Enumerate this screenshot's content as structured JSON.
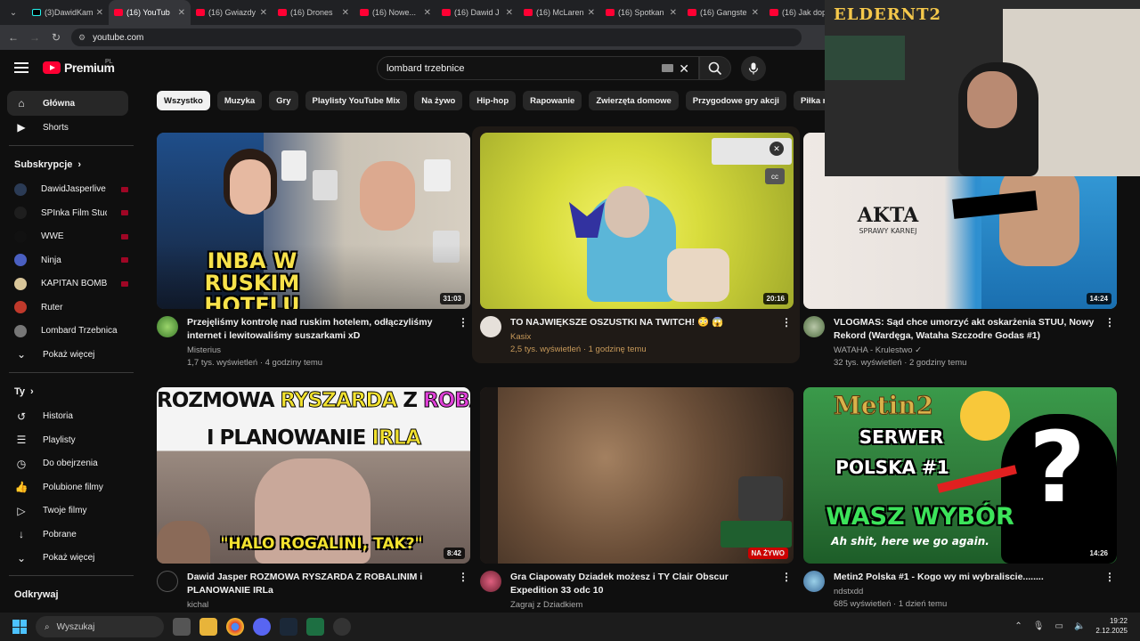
{
  "browser": {
    "tabs": [
      {
        "label": "(3)DawidKam",
        "type": "tiktok"
      },
      {
        "label": "(16) YouTub",
        "type": "youtube",
        "active": true
      },
      {
        "label": "(16) Gwiazdy",
        "type": "youtube"
      },
      {
        "label": "(16) Drones",
        "type": "youtube"
      },
      {
        "label": "(16) Nowe...",
        "type": "youtube"
      },
      {
        "label": "(16) Dawid J",
        "type": "youtube"
      },
      {
        "label": "(16) McLaren",
        "type": "youtube"
      },
      {
        "label": "(16) Spotkan",
        "type": "youtube"
      },
      {
        "label": "(16) Gangste",
        "type": "youtube"
      },
      {
        "label": "(16) Jak dop",
        "type": "youtube"
      }
    ],
    "url": "youtube.com"
  },
  "header": {
    "logo_text": "Premium",
    "logo_region": "PL",
    "search_value": "lombard trzebnice"
  },
  "sidebar": {
    "main": [
      {
        "label": "Główna",
        "icon": "home-icon"
      },
      {
        "label": "Shorts",
        "icon": "shorts-icon"
      }
    ],
    "subs_heading": "Subskrypcje",
    "subs": [
      {
        "label": "DawidJasperlive",
        "color": "#2b3b55"
      },
      {
        "label": "SPInka Film Stud...",
        "color": "#1e1e1e"
      },
      {
        "label": "WWE",
        "color": "#111111"
      },
      {
        "label": "Ninja",
        "color": "#4a5fc1"
      },
      {
        "label": "KAPITAN BOMB...",
        "color": "#d9c69a"
      },
      {
        "label": "Ruter",
        "color": "#c0392b"
      },
      {
        "label": "Lombard Trzebnica",
        "color": "#777777"
      }
    ],
    "subs_more": "Pokaż więcej",
    "you_heading": "Ty",
    "you": [
      {
        "label": "Historia",
        "icon": "history-icon"
      },
      {
        "label": "Playlisty",
        "icon": "playlist-icon"
      },
      {
        "label": "Do obejrzenia",
        "icon": "watch-later-icon"
      },
      {
        "label": "Polubione filmy",
        "icon": "like-icon"
      },
      {
        "label": "Twoje filmy",
        "icon": "your-videos-icon"
      },
      {
        "label": "Pobrane",
        "icon": "download-icon"
      }
    ],
    "you_more": "Pokaż więcej",
    "explore_heading": "Odkrywaj"
  },
  "chips": [
    "Wszystko",
    "Muzyka",
    "Gry",
    "Playlisty YouTube Mix",
    "Na żywo",
    "Hip-hop",
    "Rapowanie",
    "Zwierzęta domowe",
    "Przygodowe gry akcji",
    "Piłka nożna"
  ],
  "videos": [
    {
      "title": "Przejęliśmy kontrolę nad ruskim hotelem, odłączyliśmy internet i lewitowaliśmy suszarkami xD",
      "channel": "Misterius",
      "meta": "1,7 tys. wyświetleń · 4 godziny temu",
      "duration": "31:03",
      "thumb_text": "INBA W RUSKIM HOTELU"
    },
    {
      "title": "TO NAJWIĘKSZE OSZUSTKI NA TWITCH! 😳 😱",
      "channel": "Kasix",
      "meta": "2,5 tys. wyświetleń · 1 godzinę temu",
      "duration": "20:16",
      "thumb_text": ""
    },
    {
      "title": "VLOGMAS: Sąd chce umorzyć akt oskarżenia STUU, Nowy Rekord (Wardęga, Wataha Szczodre Godas #1)",
      "channel": "WATAHA - Krulestwo ✓",
      "meta": "32 tys. wyświetleń · 2 godziny temu",
      "duration": "14:24",
      "thumb_text": "AKTA",
      "thumb_sub": "SPRAWY KARNEJ"
    },
    {
      "title": "Dawid Jasper ROZMOWA RYSZARDA Z ROBALINIM i PLANOWANIE IRLa",
      "channel": "kichal",
      "meta": "",
      "duration": "8:42",
      "thumb_line1a": "ROZMOWA",
      "thumb_line1b": "RYSZARDA",
      "thumb_line1c": "Z",
      "thumb_line1d": "ROBALINIM",
      "thumb_line2a": "I PLANOWANIE",
      "thumb_line2b": "IRLA",
      "thumb_quote": "\"HALO ROGALINI, TAK?\""
    },
    {
      "title": "Gra Ciapowaty Dziadek możesz i TY Clair Obscur Expedition 33 odc 10",
      "channel": "Zagraj z Dziadkiem",
      "meta": "",
      "live": "NA ŻYWO"
    },
    {
      "title": "Metin2 Polska #1 - Kogo wy mi wybraliscie........",
      "channel": "ndstxdd",
      "meta": "685 wyświetleń · 1 dzień temu",
      "duration": "14:26",
      "thumb_logo": "Metin2",
      "thumb_l1": "SERWER",
      "thumb_l2": "POLSKA #1",
      "thumb_l3": "WASZ WYBÓR",
      "thumb_l4": "Ah shit, here we go again."
    }
  ],
  "webcam": {
    "logo": "ELDERNT2"
  },
  "taskbar": {
    "search_placeholder": "Wyszukaj",
    "time": "19:22",
    "date": "2.12.2025"
  }
}
